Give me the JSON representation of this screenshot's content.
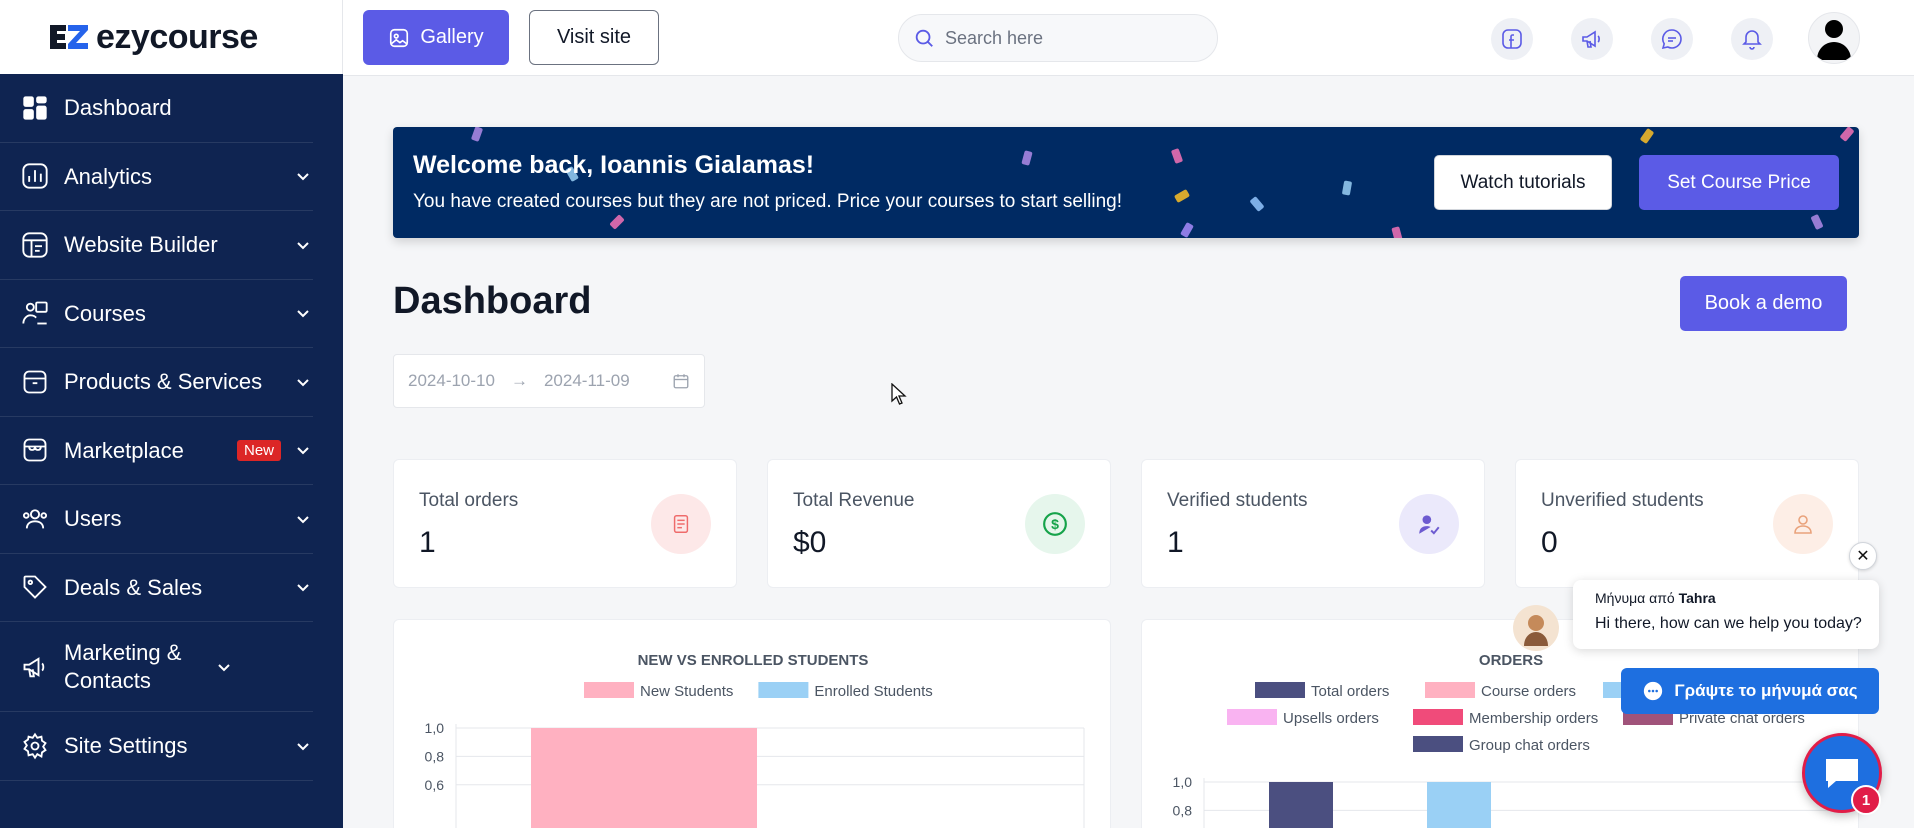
{
  "brand": {
    "name": "ezycourse"
  },
  "sidebar": {
    "items": [
      {
        "label": "Dashboard",
        "icon": "dashboard-grid-icon"
      },
      {
        "label": "Analytics",
        "icon": "bar-chart-icon"
      },
      {
        "label": "Website Builder",
        "icon": "layout-icon"
      },
      {
        "label": "Courses",
        "icon": "teacher-icon"
      },
      {
        "label": "Products & Services",
        "icon": "box-icon"
      },
      {
        "label": "Marketplace",
        "icon": "store-icon",
        "badge": "New"
      },
      {
        "label": "Users",
        "icon": "users-icon"
      },
      {
        "label": "Deals & Sales",
        "icon": "tag-icon"
      },
      {
        "label": "Marketing & Contacts",
        "icon": "megaphone-icon"
      },
      {
        "label": "Site Settings",
        "icon": "gear-icon"
      }
    ]
  },
  "topbar": {
    "gallery_label": "Gallery",
    "visit_label": "Visit site",
    "search_placeholder": "Search here"
  },
  "banner": {
    "title": "Welcome back, Ioannis Gialamas!",
    "subtitle": "You have created courses but they are not priced. Price your courses to start selling!",
    "tutorials_label": "Watch tutorials",
    "price_label": "Set Course Price"
  },
  "main": {
    "title": "Dashboard",
    "demo_label": "Book a demo",
    "date_start": "2024-10-10",
    "date_end": "2024-11-09",
    "date_separator": "→"
  },
  "stats": [
    {
      "label": "Total orders",
      "value": "1",
      "color": "#fde8e8"
    },
    {
      "label": "Total Revenue",
      "value": "$0",
      "color": "#e6f6ec"
    },
    {
      "label": "Verified students",
      "value": "1",
      "color": "#ebe9fb"
    },
    {
      "label": "Unverified students",
      "value": "0",
      "color": "#fdeee6"
    }
  ],
  "chat": {
    "from_prefix": "Μήνυμα από",
    "from_name": "Tahra",
    "message": "Hi there, how can we help you today?",
    "reply_label": "Γράψτε το μήνυμά σας",
    "unread": "1",
    "close_glyph": "✕"
  },
  "colors": {
    "accent": "#5b5be6",
    "sidebar": "#0f2451",
    "banner": "#002a63"
  },
  "chart_data": [
    {
      "type": "bar",
      "title": "NEW VS ENROLLED STUDENTS",
      "series": [
        {
          "name": "New Students",
          "color": "#ffb1c1",
          "values": [
            1
          ]
        },
        {
          "name": "Enrolled Students",
          "color": "#9ad0f5",
          "values": [
            0
          ]
        }
      ],
      "y_ticks": [
        "1,0",
        "0,8",
        "0,6"
      ],
      "ylim": [
        0,
        1
      ],
      "grid": true,
      "legend": "top"
    },
    {
      "type": "bar",
      "title": "ORDERS",
      "series": [
        {
          "name": "Total orders",
          "color": "#4b4f80",
          "values": [
            1
          ]
        },
        {
          "name": "Course orders",
          "color": "#ffb1c1",
          "values": [
            0
          ]
        },
        {
          "name": "",
          "color": "#9ad0f5",
          "values": [
            1
          ]
        },
        {
          "name": "",
          "color": "#ffe29a",
          "values": [
            0
          ]
        },
        {
          "name": "Upsells orders",
          "color": "#f9b3f1",
          "values": [
            0
          ]
        },
        {
          "name": "Membership orders",
          "color": "#f04b7a",
          "values": [
            0
          ]
        },
        {
          "name": "Private chat orders",
          "color": "#a0537a",
          "values": [
            0
          ]
        },
        {
          "name": "Group chat orders",
          "color": "#4b4f80",
          "values": [
            0
          ]
        }
      ],
      "y_ticks": [
        "1,0",
        "0,8"
      ],
      "ylim": [
        0,
        1
      ],
      "grid": true,
      "legend": "top"
    }
  ]
}
